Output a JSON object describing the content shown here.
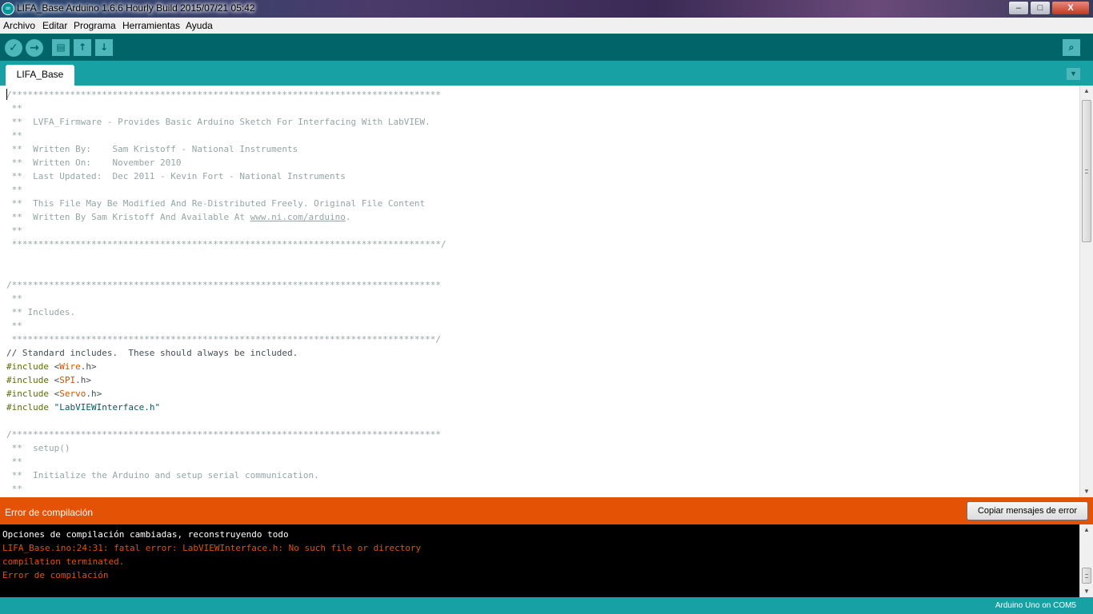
{
  "window": {
    "title": "LIFA_Base Arduino 1.6.6 Hourly Build 2015/07/21 05:42",
    "app_icon": "arduino-logo-icon",
    "controls": {
      "minimize": "–",
      "maximize": "□",
      "close": "X"
    }
  },
  "menu": [
    "Archivo",
    "Editar",
    "Programa",
    "Herramientas",
    "Ayuda"
  ],
  "toolbar": {
    "verify_glyph": "✓",
    "upload_glyph": "→",
    "new_glyph": "▤",
    "open_glyph": "↑",
    "save_glyph": "↓",
    "serial_monitor_glyph": "⌕"
  },
  "tabs": {
    "active": "LIFA_Base",
    "menu_glyph": "▼"
  },
  "editor": {
    "lines": [
      "/*********************************************************************************",
      " **",
      " **  LVFA_Firmware - Provides Basic Arduino Sketch For Interfacing With LabVIEW.",
      " **",
      " **  Written By:    Sam Kristoff - National Instruments",
      " **  Written On:    November 2010",
      " **  Last Updated:  Dec 2011 - Kevin Fort - National Instruments",
      " **",
      " **  This File May Be Modified And Re-Distributed Freely. Original File Content",
      " **  Written By Sam Kristoff And Available At ",
      " **",
      " *********************************************************************************/",
      "",
      "",
      "/*********************************************************************************",
      " **",
      " ** Includes.",
      " **",
      " ********************************************************************************/",
      "// Standard includes.  These should always be included.",
      "",
      "",
      "",
      "",
      "",
      "/*********************************************************************************",
      " **  setup()",
      " **",
      " **  Initialize the Arduino and setup serial communication.",
      " **"
    ],
    "link_text": "www.ni.com/arduino",
    "link_suffix": ".",
    "includes": [
      {
        "directive": "#include",
        "open": " <",
        "name": "Wire",
        "close": ".h>"
      },
      {
        "directive": "#include",
        "open": " <",
        "name": "SPI",
        "close": ".h>"
      },
      {
        "directive": "#include",
        "open": " <",
        "name": "Servo",
        "close": ".h>"
      },
      {
        "directive": "#include",
        "open": " ",
        "name": "\"LabVIEWInterface.h\"",
        "close": ""
      }
    ]
  },
  "status": {
    "message": "Error de compilación",
    "copy_button": "Copiar mensajes de error"
  },
  "console": {
    "lines": [
      {
        "text": "Opciones de compilación cambiadas, reconstruyendo todo",
        "kind": "info"
      },
      {
        "text": "LIFA_Base.ino:24:31: fatal error: LabVIEWInterface.h: No such file or directory",
        "kind": "error"
      },
      {
        "text": "compilation terminated.",
        "kind": "error"
      },
      {
        "text": "Error de compilación",
        "kind": "error"
      }
    ]
  },
  "footer": {
    "board": "Arduino Uno on COM5"
  },
  "colors": {
    "teal_dark": "#006468",
    "teal": "#17a1a5",
    "error_orange": "#e35205",
    "comment": "#95a5a6",
    "library": "#d35400"
  }
}
